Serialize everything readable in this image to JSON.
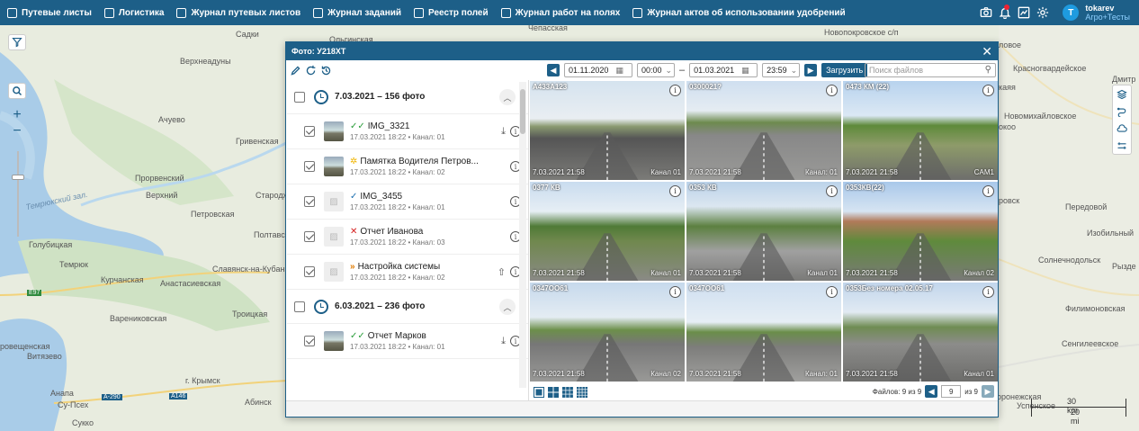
{
  "nav": [
    {
      "label": "Путевые листы"
    },
    {
      "label": "Логистика"
    },
    {
      "label": "Журнал путевых листов"
    },
    {
      "label": "Журнал заданий"
    },
    {
      "label": "Реестр полей"
    },
    {
      "label": "Журнал работ на полях"
    },
    {
      "label": "Журнал актов об использовании удобрений"
    }
  ],
  "user": {
    "name": "tokarev",
    "org": "Агро+Тесты",
    "initial": "T"
  },
  "icons": {
    "camera": "camera-icon",
    "bell": "bell-icon",
    "chart": "chart-icon",
    "gear": "gear-icon"
  },
  "map_labels": [
    {
      "t": "Садки"
    },
    {
      "t": "Ольгинская"
    },
    {
      "t": "Верхнеадуны"
    },
    {
      "t": "Ачуево"
    },
    {
      "t": "Гривенская"
    },
    {
      "t": "Темрюкский зал."
    },
    {
      "t": "Прорвенский"
    },
    {
      "t": "Верхний"
    },
    {
      "t": "Стародж"
    },
    {
      "t": "Петровская"
    },
    {
      "t": "Полтавск"
    },
    {
      "t": "Голубицкая"
    },
    {
      "t": "Темрюк"
    },
    {
      "t": "Славянск-на-Кубани"
    },
    {
      "t": "Курчанская"
    },
    {
      "t": "Анастасиевская"
    },
    {
      "t": "E97"
    },
    {
      "t": "Троицкая"
    },
    {
      "t": "Варениковская"
    },
    {
      "t": "ровещенская"
    },
    {
      "t": "Витязево"
    },
    {
      "t": "г. Крымск"
    },
    {
      "t": "Анапа"
    },
    {
      "t": "Су-Псех"
    },
    {
      "t": "A-290"
    },
    {
      "t": "A146"
    },
    {
      "t": "Абинск"
    },
    {
      "t": "Сукко"
    },
    {
      "t": "Новопокровское с/п"
    },
    {
      "t": "Красногвардейское"
    },
    {
      "t": "Дмитр"
    },
    {
      "t": "Новомихайловское"
    },
    {
      "t": "Передовой"
    },
    {
      "t": "Изобильный"
    },
    {
      "t": "Солнечнодольск"
    },
    {
      "t": "Рызде"
    },
    {
      "t": "Филимоновская"
    },
    {
      "t": "Сенгилеевское"
    },
    {
      "t": "Успенское"
    },
    {
      "t": "оронежская"
    },
    {
      "t": "ловое"
    },
    {
      "t": "Чепасская"
    },
    {
      "t": "ровск"
    },
    {
      "t": "каяя"
    },
    {
      "t": "окоо"
    }
  ],
  "scale": {
    "km": "30 km",
    "mi": "20 mi"
  },
  "modal": {
    "title": "Фото: У218ХТ",
    "date_from": "01.11.2020",
    "time_from": "00:00",
    "date_to": "01.03.2021",
    "time_to": "23:59",
    "dash": "–",
    "load": "Загрузить",
    "search_placeholder": "Поиск файлов"
  },
  "groups": [
    {
      "title": "7.03.2021 – 156 фото",
      "items": [
        {
          "name": "IMG_3321",
          "meta": "17.03.2021 18:22 • Канал: 01",
          "status": "✓✓",
          "status_color": "#2a9d3a",
          "thumb": "img",
          "download": true
        },
        {
          "name": "Памятка Водителя Петров...",
          "meta": "17.03.2021 18:22 • Канал: 02",
          "status": "✲",
          "status_color": "#f0b400",
          "thumb": "img",
          "download": false
        },
        {
          "name": "IMG_3455",
          "meta": "17.03.2021 18:22 • Канал: 01",
          "status": "✓",
          "status_color": "#1d6fb0",
          "thumb": "ph",
          "download": false
        },
        {
          "name": "Отчет Иванова",
          "meta": "17.03.2021 18:22 • Канал: 03",
          "status": "✕",
          "status_color": "#d52020",
          "thumb": "ph",
          "download": false
        },
        {
          "name": "Настройка системы",
          "meta": "17.03.2021 18:22 • Канал: 02",
          "status": "»",
          "status_color": "#e07a00",
          "thumb": "ph",
          "upload": true
        }
      ]
    },
    {
      "title": "6.03.2021 – 236 фото",
      "items": [
        {
          "name": "Отчет Марков",
          "meta": "17.03.2021 18:22 • Канал: 01",
          "status": "✓✓",
          "status_color": "#2a9d3a",
          "thumb": "img",
          "download": true
        }
      ]
    }
  ],
  "photos": [
    {
      "top": "А433А123",
      "date": "7.03.2021 21:58",
      "ch": "Канал 01"
    },
    {
      "top": "0300021?",
      "date": "7.03.2021 21:58",
      "ch": "Канал: 01"
    },
    {
      "top": "0473 КМ (22)",
      "date": "7.03.2021 21:58",
      "ch": "CAM1"
    },
    {
      "top": "0377 КВ",
      "date": "7.03.2021 21:58",
      "ch": "Канал 01"
    },
    {
      "top": "0353 КВ",
      "date": "7.03.2021 21:58",
      "ch": "Канал 01"
    },
    {
      "top": "0353КВ(22)",
      "date": "7.03.2021 21:58",
      "ch": "Канал 02"
    },
    {
      "top": "0347ОО61",
      "date": "7.03.2021 21:58",
      "ch": "Канал 02"
    },
    {
      "top": "0347ОО61",
      "date": "7.03.2021 21:58",
      "ch": "Канал: 01"
    },
    {
      "top": "0353Без номера 02.05.17",
      "date": "7.03.2021 21:58",
      "ch": "Канал 01"
    }
  ],
  "pager": {
    "files": "Файлов: 9 из 9",
    "page": "9",
    "of": "из 9"
  }
}
